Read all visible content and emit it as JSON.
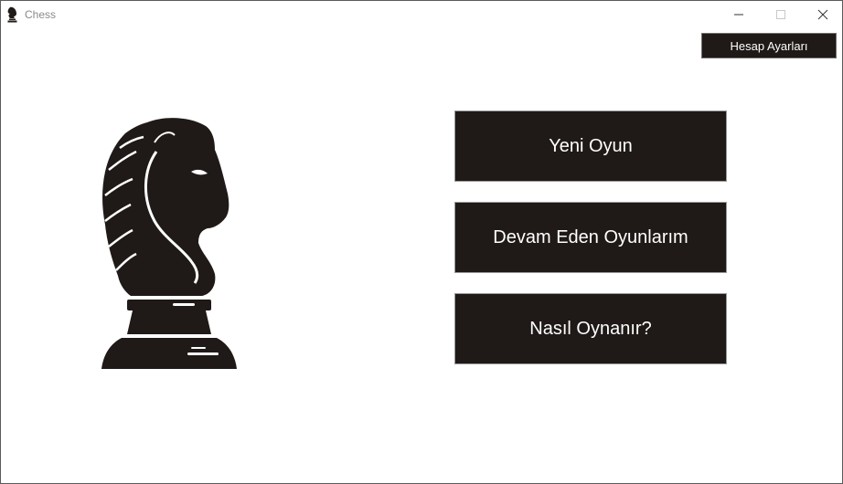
{
  "window": {
    "title": "Chess",
    "app_icon": "chess-knight-icon",
    "controls": [
      "minimize-icon",
      "maximize-icon",
      "close-icon"
    ]
  },
  "header": {
    "account_settings_label": "Hesap Ayarları"
  },
  "menu": {
    "new_game_label": "Yeni Oyun",
    "ongoing_games_label": "Devam Eden Oyunlarım",
    "how_to_play_label": "Nasıl Oynanır?"
  },
  "logo": {
    "icon": "chess-knight-logo"
  },
  "colors": {
    "button_background": "#1f1a17",
    "button_text": "#ffffff",
    "knight": "#1f1a17",
    "background": "#ffffff"
  }
}
